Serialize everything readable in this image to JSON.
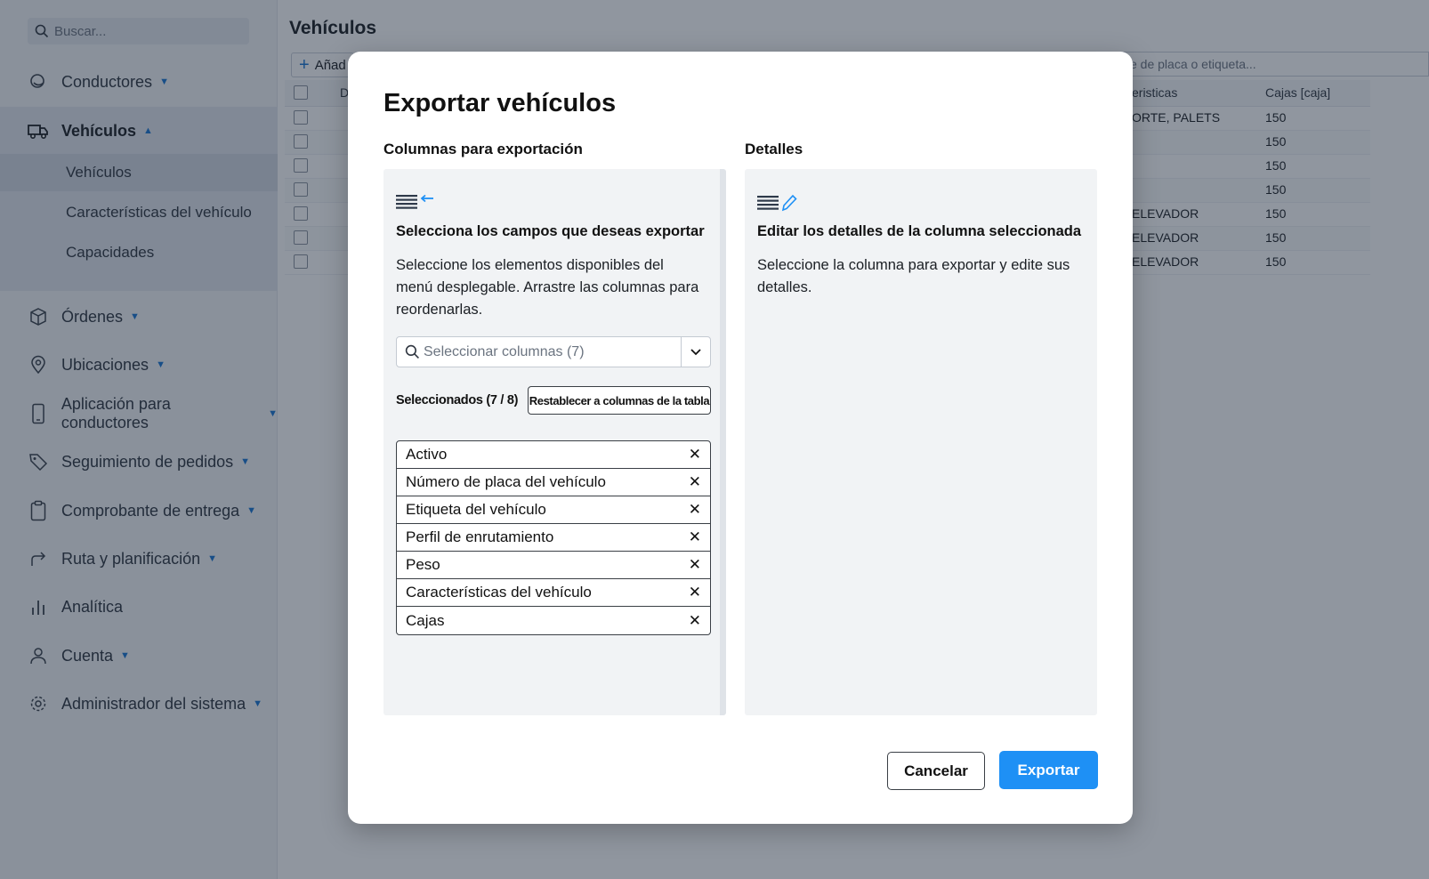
{
  "sidebar": {
    "search_placeholder": "Buscar...",
    "items": [
      {
        "label": "Conductores",
        "icon": "drivers-icon"
      },
      {
        "label": "Vehículos",
        "icon": "truck-icon"
      },
      {
        "label": "Órdenes",
        "icon": "box-icon"
      },
      {
        "label": "Ubicaciones",
        "icon": "location-pin-icon"
      },
      {
        "label": "Aplicación para conductores",
        "icon": "phone-icon"
      },
      {
        "label": "Seguimiento de pedidos",
        "icon": "tag-icon"
      },
      {
        "label": "Comprobante de entrega",
        "icon": "clipboard-icon"
      },
      {
        "label": "Ruta y planificación",
        "icon": "route-icon"
      },
      {
        "label": "Analítica",
        "icon": "bar-chart-icon"
      },
      {
        "label": "Cuenta",
        "icon": "user-icon"
      },
      {
        "label": "Administrador del sistema",
        "icon": "gear-icon"
      }
    ],
    "subitems": [
      "Vehículos",
      "Características del vehículo",
      "Capacidades"
    ]
  },
  "main": {
    "title": "Vehículos",
    "add_label": "Añad",
    "search_placeholder": "e de placa o etiqueta...",
    "col_d": "D",
    "col_features": "eristicas",
    "col_boxes": "Cajas [caja]",
    "rows": [
      {
        "features": "ORTE, PALETS",
        "boxes": "150"
      },
      {
        "features": "",
        "boxes": "150"
      },
      {
        "features": "",
        "boxes": "150"
      },
      {
        "features": "",
        "boxes": "150"
      },
      {
        "features": "ELEVADOR",
        "boxes": "150"
      },
      {
        "features": "ELEVADOR",
        "boxes": "150"
      },
      {
        "features": "ELEVADOR",
        "boxes": "150"
      }
    ]
  },
  "modal": {
    "title": "Exportar vehículos",
    "left_label": "Columnas para exportación",
    "right_label": "Detalles",
    "left_heading": "Selecciona los campos que deseas exportar",
    "left_desc": "Seleccione los elementos disponibles del menú desplegable. Arrastre las columnas para reordenarlas.",
    "select_placeholder": "Seleccionar columnas (7)",
    "selected_count": "Seleccionados (7 / 8)",
    "reset_label": "Restablecer a columnas de la tabla",
    "columns": [
      "Activo",
      "Número de placa del vehículo",
      "Etiqueta del vehículo",
      "Perfil de enrutamiento",
      "Peso",
      "Características del vehículo",
      "Cajas"
    ],
    "remove_glyph": "✕",
    "right_heading": "Editar los detalles de la columna seleccionada",
    "right_desc": "Seleccione la columna para exportar y edite sus detalles.",
    "cancel_label": "Cancelar",
    "export_label": "Exportar"
  },
  "colors": {
    "accent": "#1e90f5",
    "nav_caret": "#1976d2"
  }
}
